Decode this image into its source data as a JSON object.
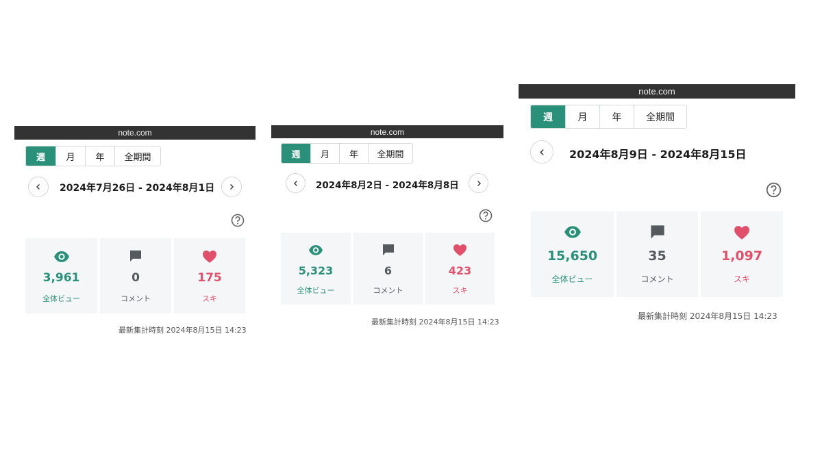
{
  "panels": [
    {
      "site": "note.com",
      "tabs": [
        "週",
        "月",
        "年",
        "全期間"
      ],
      "active_tab": 0,
      "date_range": "2024年7月26日 - 2024年8月1日",
      "stats": [
        {
          "value": "3,961",
          "label": "全体ビュー",
          "icon": "eye-icon"
        },
        {
          "value": "0",
          "label": "コメント",
          "icon": "comment-icon"
        },
        {
          "value": "175",
          "label": "スキ",
          "icon": "heart-icon"
        }
      ],
      "updated": "最新集計時刻 2024年8月15日 14:23"
    },
    {
      "site": "note.com",
      "tabs": [
        "週",
        "月",
        "年",
        "全期間"
      ],
      "active_tab": 0,
      "date_range": "2024年8月2日 - 2024年8月8日",
      "stats": [
        {
          "value": "5,323",
          "label": "全体ビュー",
          "icon": "eye-icon"
        },
        {
          "value": "6",
          "label": "コメント",
          "icon": "comment-icon"
        },
        {
          "value": "423",
          "label": "スキ",
          "icon": "heart-icon"
        }
      ],
      "updated": "最新集計時刻 2024年8月15日 14:23"
    },
    {
      "site": "note.com",
      "tabs": [
        "週",
        "月",
        "年",
        "全期間"
      ],
      "active_tab": 0,
      "date_range": "2024年8月9日 - 2024年8月15日",
      "stats": [
        {
          "value": "15,650",
          "label": "全体ビュー",
          "icon": "eye-icon"
        },
        {
          "value": "35",
          "label": "コメント",
          "icon": "comment-icon"
        },
        {
          "value": "1,097",
          "label": "スキ",
          "icon": "heart-icon"
        }
      ],
      "updated": "最新集計時刻 2024年8月15日 14:23"
    }
  ],
  "colors": {
    "accent": "#2a9079",
    "comment": "#555a5e",
    "heart": "#e0506b",
    "card_bg": "#f5f6f7",
    "bar_bg": "#333333"
  }
}
